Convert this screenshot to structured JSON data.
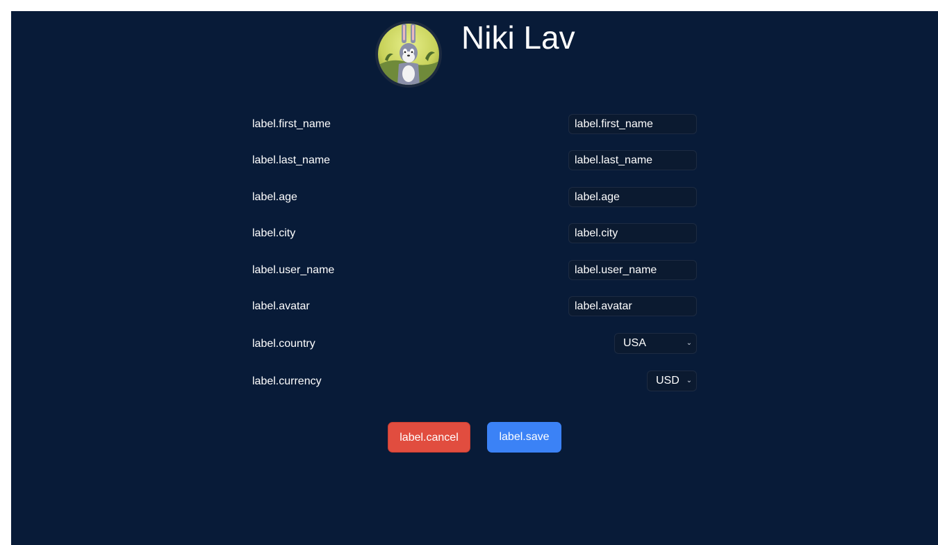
{
  "profile": {
    "name": "Niki Lav"
  },
  "fields": [
    {
      "label": "label.first_name",
      "value": "label.first_name"
    },
    {
      "label": "label.last_name",
      "value": "label.last_name"
    },
    {
      "label": "label.age",
      "value": "label.age"
    },
    {
      "label": "label.city",
      "value": "label.city"
    },
    {
      "label": "label.user_name",
      "value": "label.user_name"
    },
    {
      "label": "label.avatar",
      "value": "label.avatar"
    }
  ],
  "country": {
    "label": "label.country",
    "value": "USA"
  },
  "currency": {
    "label": "label.currency",
    "value": "USD"
  },
  "actions": {
    "cancel_label": "label.cancel",
    "save_label": "label.save"
  },
  "colors": {
    "background": "#081b38",
    "cancel": "#e14d3f",
    "save": "#3b82f6"
  }
}
